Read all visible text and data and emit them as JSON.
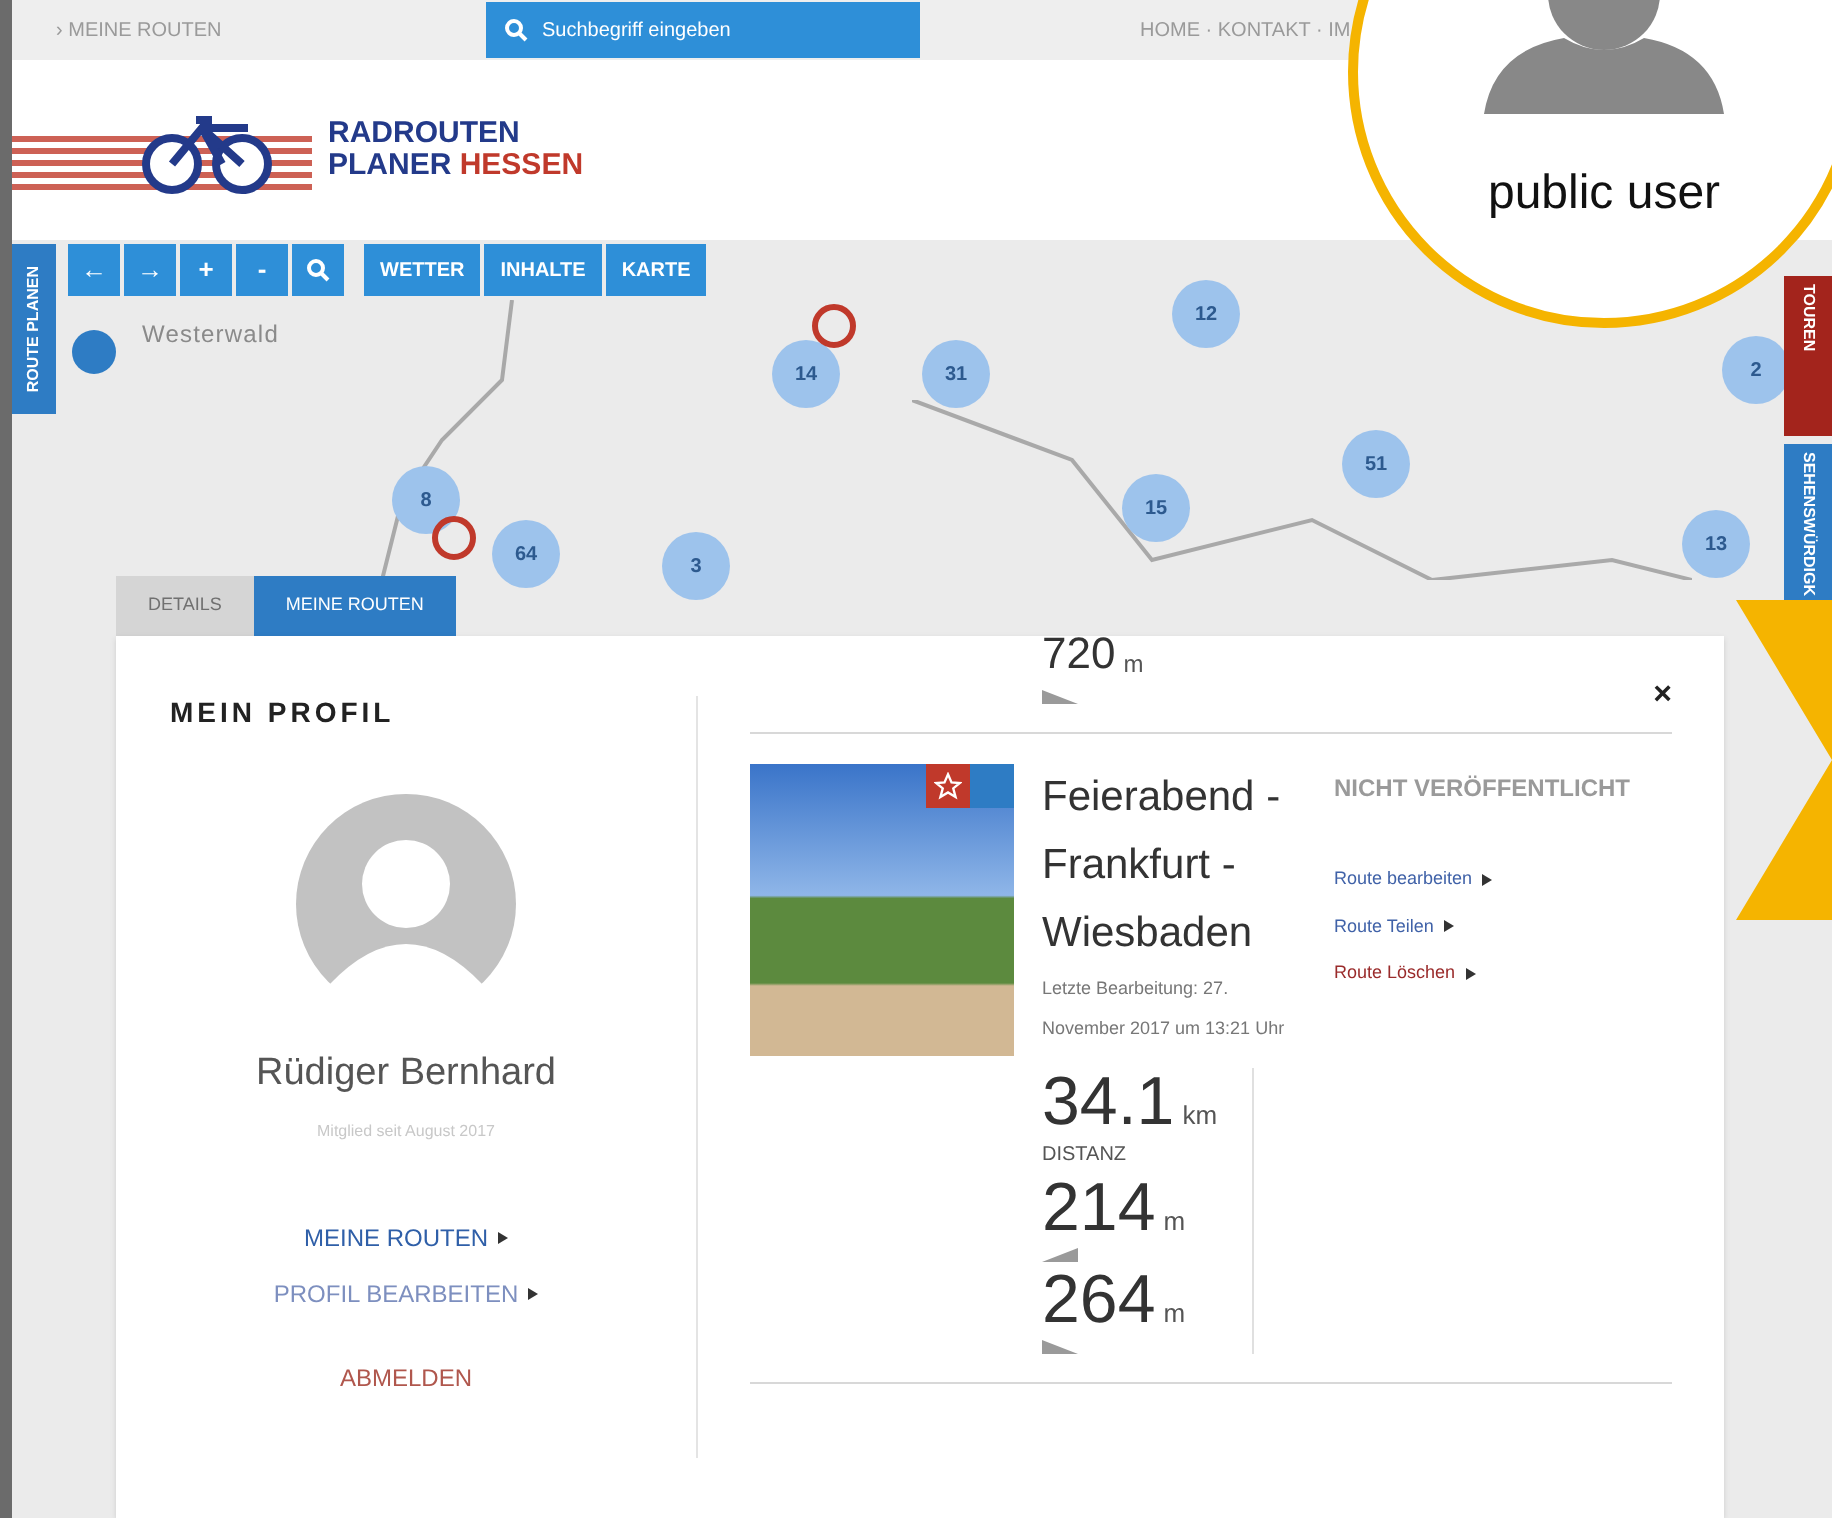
{
  "top_bar": {
    "breadcrumb": "› MEINE ROUTEN",
    "search": {
      "placeholder": "Suchbegriff eingeben"
    },
    "nav": "HOME · KONTAKT · IM"
  },
  "logo": {
    "line1": "RADROUTEN",
    "line2_a": "PLANER",
    "line2_b": "HESSEN"
  },
  "map": {
    "toolbar_icons": [
      {
        "kind": "text",
        "label": "←"
      },
      {
        "kind": "text",
        "label": "→"
      },
      {
        "kind": "text",
        "label": "+"
      },
      {
        "kind": "text",
        "label": "-"
      },
      {
        "kind": "search"
      }
    ],
    "toolbar_buttons": [
      "WETTER",
      "INHALTE",
      "KARTE"
    ],
    "side_tab": "ROUTE PLANEN",
    "right_tabs": [
      {
        "label": "TOUREN",
        "color": "#a3241c"
      },
      {
        "label": "SEHENSWÜRDIGK",
        "color": "#2e7cc4"
      }
    ],
    "region_label": "Westerwald",
    "clusters": [
      "14",
      "31",
      "12",
      "8",
      "3",
      "64",
      "15",
      "51",
      "2",
      "13"
    ],
    "panel_tabs": [
      {
        "label": "DETAILS",
        "selected": false
      },
      {
        "label": "MEINE ROUTEN",
        "selected": true
      }
    ]
  },
  "profile": {
    "heading": "MEIN PROFIL",
    "name": "Rüdiger Bernhard",
    "member_since": "Mitglied seit August 2017",
    "links": [
      {
        "label": "MEINE ROUTEN",
        "kind": "primary"
      },
      {
        "label": "PROFIL BEARBEITEN",
        "kind": "secondary"
      },
      {
        "label": "ABMELDEN",
        "kind": "danger"
      }
    ]
  },
  "routes": {
    "previous_value": "720",
    "previous_unit": "m",
    "close": "×",
    "route": {
      "title": "Feierabend - Frankfurt - Wiesbaden",
      "edited": "Letzte Bearbeitung: 27. November 2017 um 13:21 Uhr",
      "status": "NICHT VERÖFFENTLICHT",
      "distance": {
        "value": "34.1",
        "unit": "km",
        "label": "DISTANZ"
      },
      "ascent": {
        "value": "214",
        "unit": "m"
      },
      "descent": {
        "value": "264",
        "unit": "m"
      },
      "actions": [
        {
          "label": "Route bearbeiten",
          "kind": "normal"
        },
        {
          "label": "Route Teilen",
          "kind": "normal"
        },
        {
          "label": "Route Löschen",
          "kind": "danger"
        }
      ]
    }
  },
  "callout": {
    "label": "public user"
  }
}
